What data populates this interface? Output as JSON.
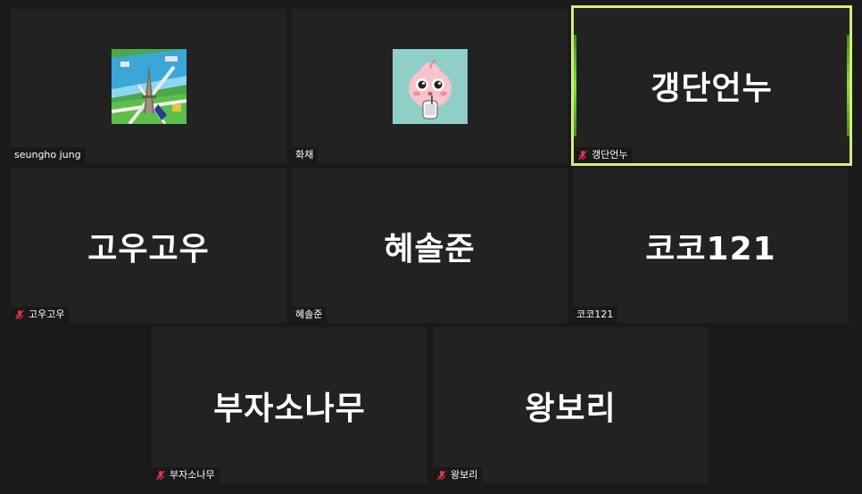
{
  "participants": [
    {
      "tile_name": "",
      "label": "seungho jung",
      "muted": false,
      "avatar": "paris-map-avatar"
    },
    {
      "tile_name": "",
      "label": "화채",
      "muted": false,
      "avatar": "peach-character-avatar"
    },
    {
      "tile_name": "갱단언누",
      "label": "갱단언누",
      "muted": true,
      "active": true
    },
    {
      "tile_name": "고우고우",
      "label": "고우고우",
      "muted": true
    },
    {
      "tile_name": "혜솔준",
      "label": "혜솔준",
      "muted": false
    },
    {
      "tile_name": "코코121",
      "label": "코코121",
      "muted": false
    },
    {
      "tile_name": "부자소나무",
      "label": "부자소나무",
      "muted": true
    },
    {
      "tile_name": "왕보리",
      "label": "왕보리",
      "muted": true
    }
  ],
  "colors": {
    "background": "#1a1a1a",
    "tile": "#222222",
    "active_border": "#d9ec75",
    "muted_icon": "#e0344a"
  }
}
